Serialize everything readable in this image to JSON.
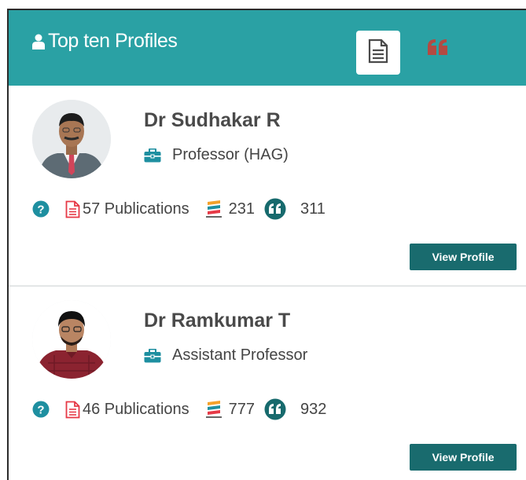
{
  "header": {
    "title": "Top ten Profiles",
    "tabs": [
      {
        "icon": "document-icon",
        "active": true
      },
      {
        "icon": "quote-icon",
        "active": false
      }
    ],
    "colors": {
      "background": "#2aa1a4",
      "quote_icon": "#b44a42"
    }
  },
  "profiles": [
    {
      "name": "Dr Sudhakar R",
      "designation": "Professor (HAG)",
      "publications": "57 Publications",
      "scopus_count": "231",
      "citations": "311",
      "button": "View Profile"
    },
    {
      "name": "Dr Ramkumar T",
      "designation": "Assistant Professor",
      "publications": "46 Publications",
      "scopus_count": "777",
      "citations": "932",
      "button": "View Profile"
    }
  ],
  "colors": {
    "accent": "#1e8fa0",
    "button": "#196b6e",
    "publication_icon": "#e63946",
    "citation_icon": "#176a6d"
  }
}
